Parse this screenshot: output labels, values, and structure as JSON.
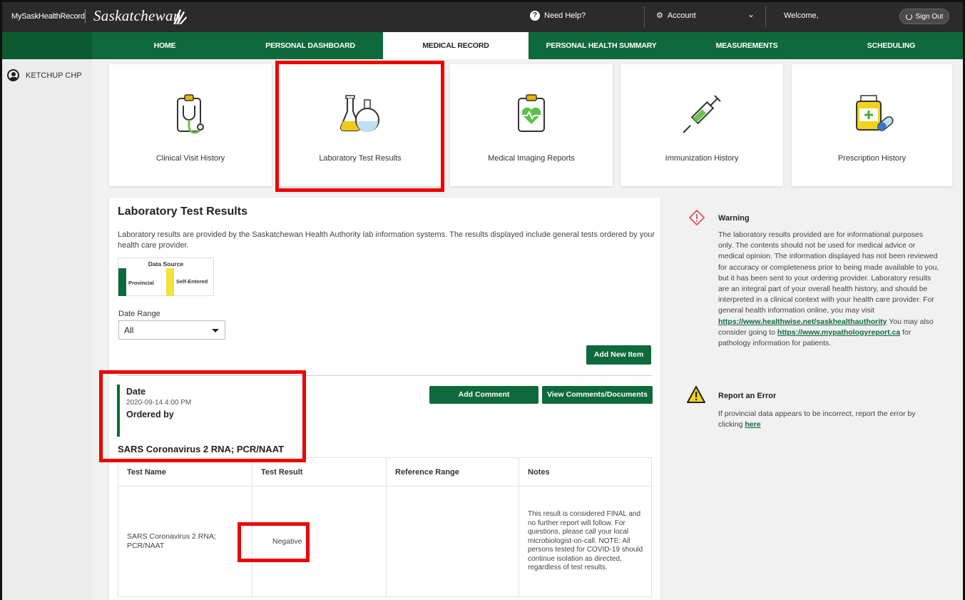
{
  "topbar": {
    "brand_small": "MySaskHealthRecord",
    "brand_big": "Saskatchewan",
    "help": "Need Help?",
    "account": "Account",
    "welcome": "Welcome,",
    "signout": "Sign Out"
  },
  "nav": {
    "tabs": [
      "HOME",
      "PERSONAL DASHBOARD",
      "MEDICAL RECORD",
      "PERSONAL HEALTH SUMMARY",
      "MEASUREMENTS",
      "SCHEDULING"
    ],
    "active": "MEDICAL RECORD"
  },
  "sidebar": {
    "user": "KETCHUP CHP"
  },
  "tiles": [
    {
      "label": "Clinical Visit History",
      "icon": "clipboard-stethoscope-icon"
    },
    {
      "label": "Laboratory Test Results",
      "icon": "lab-flasks-icon"
    },
    {
      "label": "Medical Imaging Reports",
      "icon": "clipboard-heart-icon"
    },
    {
      "label": "Immunization History",
      "icon": "syringe-icon"
    },
    {
      "label": "Prescription History",
      "icon": "pill-bottle-icon"
    }
  ],
  "panel": {
    "title": "Laboratory Test Results",
    "description": "Laboratory results are provided by the Saskatchewan Health Authority lab information systems. The results displayed include general tests ordered by your health care provider.",
    "data_source": {
      "title": "Data Source",
      "provincial": "Provincial",
      "self_entered": "Self-Entered",
      "provincial_color": "#0f6a3b",
      "self_entered_color": "#f3e23a"
    },
    "date_range_label": "Date Range",
    "date_range_value": "All",
    "add_new_item": "Add New Item",
    "add_comment": "Add Comment",
    "view_comments": "View Comments/Documents",
    "date_label": "Date",
    "date_value": "2020-09-14 4:00 PM",
    "ordered_by_label": "Ordered by",
    "test_title": "SARS Coronavirus 2 RNA; PCR/NAAT",
    "table": {
      "headers": [
        "Test Name",
        "Test Result",
        "Reference Range",
        "Notes"
      ],
      "row": {
        "test_name": "SARS Coronavirus 2 RNA; PCR/NAAT",
        "result": "Negative",
        "reference_range": "",
        "notes": "This result is considered FINAL and no further report will follow. For questions, please call your local microbiologist-on-call. NOTE: All persons tested for COVID-19 should continue isolation as directed, regardless of test results."
      }
    }
  },
  "warning": {
    "title": "Warning",
    "text_1": "The laboratory results provided are for informational purposes only. The contents should not be used for medical advice or medical opinion. The information displayed has not been reviewed for accuracy or completeness prior to being made available to you, but it has been sent to your ordering provider. Laboratory results are an integral part of your overall health history, and should be interpreted in a clinical context with your health care provider. For general health information online, you may visit",
    "link_1": "https://www.healthwise.net/saskhealthauthority",
    "text_2": "You may also consider going to",
    "link_2": "https://www.mypathologyreport.ca",
    "text_3": "for pathology information for patients."
  },
  "report_error": {
    "title": "Report an Error",
    "text": "If provincial data appears to be incorrect, report the error by clicking",
    "link": "here"
  },
  "colors": {
    "brand_green": "#0f6a3b",
    "topbar": "#2b2b2b",
    "highlight_red": "#ee0000"
  }
}
